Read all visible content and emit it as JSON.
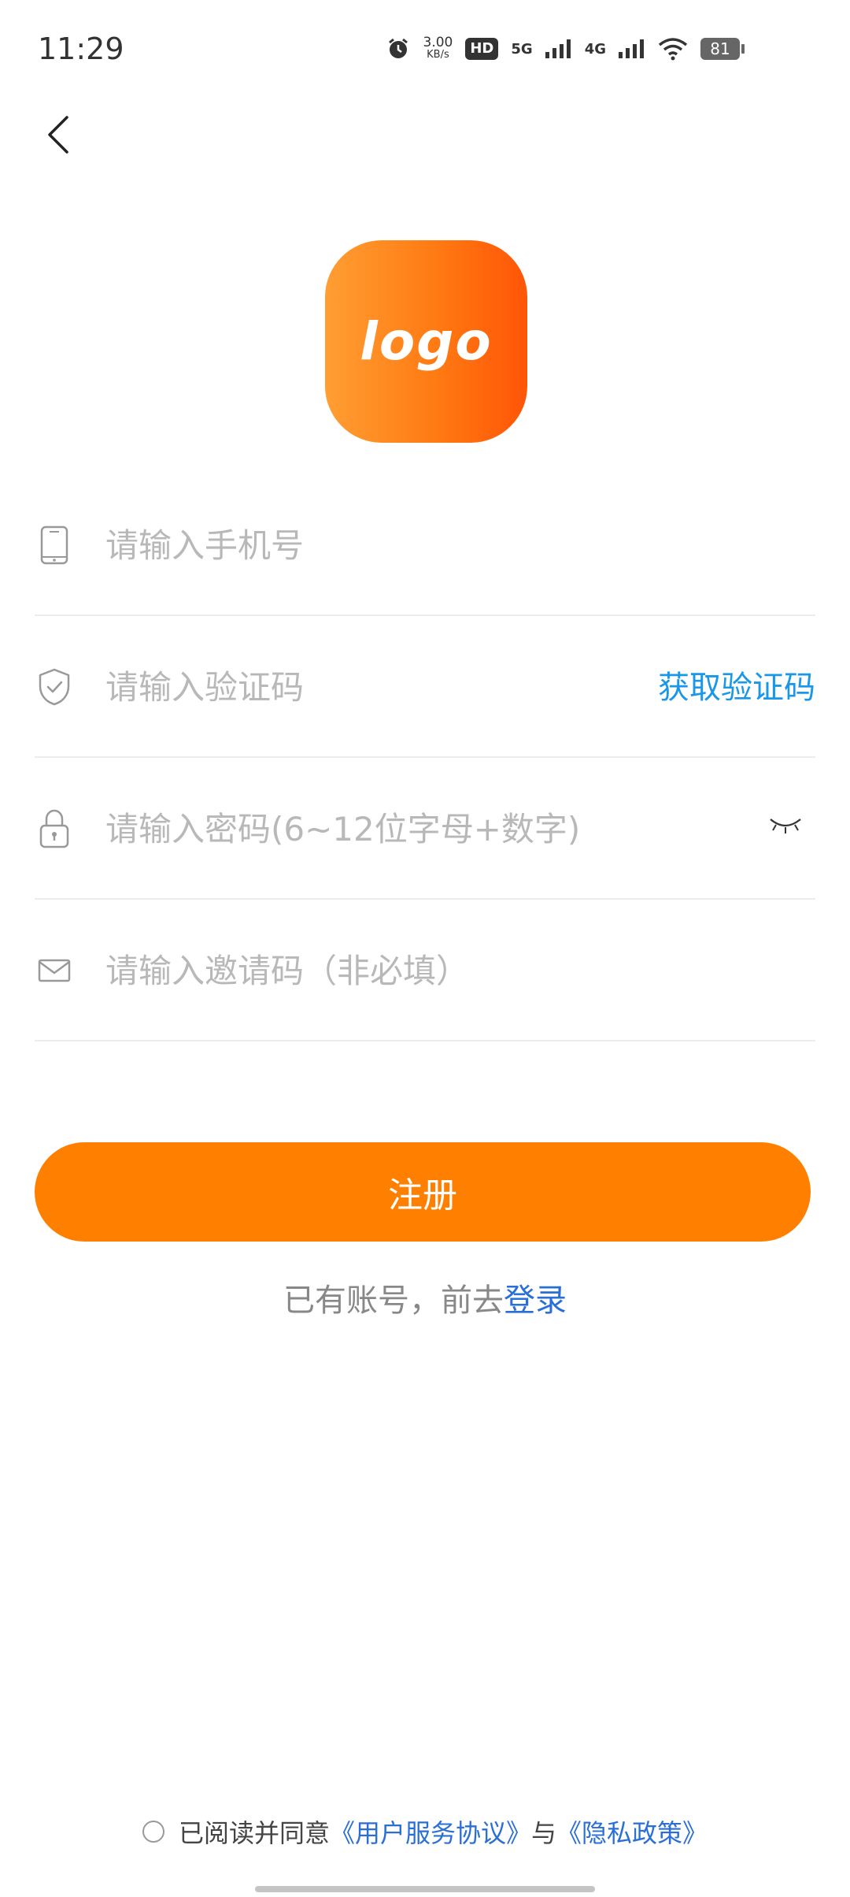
{
  "status_bar": {
    "time": "11:29",
    "net_speed_value": "3.00",
    "net_speed_unit": "KB/s",
    "hd_label": "HD",
    "net_5g": "5G",
    "net_4g": "4G",
    "battery": "81"
  },
  "logo": {
    "text": "logo"
  },
  "form": {
    "phone_placeholder": "请输入手机号",
    "code_placeholder": "请输入验证码",
    "get_code_label": "获取验证码",
    "password_placeholder": "请输入密码(6~12位字母+数字)",
    "invite_placeholder": "请输入邀请码（非必填）"
  },
  "register": {
    "label": "注册"
  },
  "login_prompt": {
    "text": "已有账号，前去",
    "link": "登录"
  },
  "agreement": {
    "prefix": "已阅读并同意",
    "terms": "《用户服务协议》",
    "and": "与",
    "privacy": "《隐私政策》"
  },
  "colors": {
    "accent": "#ff7f00",
    "link_blue": "#1a97e8",
    "text_blue": "#2a6fd6"
  },
  "icons": [
    "back-icon",
    "phone-icon",
    "shield-icon",
    "lock-icon",
    "eye-closed-icon",
    "mail-icon"
  ]
}
